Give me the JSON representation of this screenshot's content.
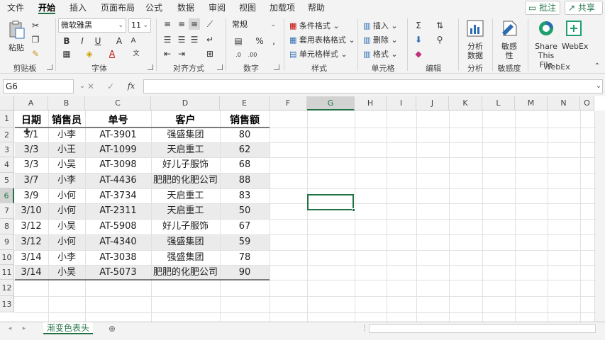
{
  "menu": {
    "tabs": [
      "文件",
      "开始",
      "插入",
      "页面布局",
      "公式",
      "数据",
      "审阅",
      "视图",
      "加载项",
      "帮助"
    ],
    "active_tab": "开始",
    "comment_label": "批注",
    "share_label": "共享"
  },
  "ribbon": {
    "clipboard": {
      "paste_label": "粘贴",
      "group_label": "剪贴板"
    },
    "font": {
      "font_name": "微软雅黑",
      "font_size": "11",
      "group_label": "字体"
    },
    "alignment": {
      "group_label": "对齐方式"
    },
    "number": {
      "format": "常规",
      "group_label": "数字"
    },
    "styles": {
      "conditional_format": "条件格式",
      "table_format": "套用表格格式",
      "cell_styles": "单元格样式",
      "group_label": "样式"
    },
    "cells": {
      "insert": "插入",
      "delete": "删除",
      "format": "格式",
      "group_label": "单元格"
    },
    "editing": {
      "group_label": "编辑"
    },
    "analysis": {
      "button_label_1": "分析",
      "button_label_2": "数据",
      "group_label": "分析"
    },
    "sensitivity": {
      "button_label_1": "敏感",
      "button_label_2": "性",
      "group_label": "敏感度"
    },
    "webex": {
      "share_label_1": "Share",
      "share_label_2": "This File",
      "webex_label": "WebEx",
      "group_label": "WebEx"
    }
  },
  "formula_bar": {
    "name_box": "G6",
    "fx": "fx",
    "value": ""
  },
  "columns": [
    "A",
    "B",
    "C",
    "D",
    "E",
    "F",
    "G",
    "H",
    "I",
    "J",
    "K",
    "L",
    "M",
    "N",
    "O"
  ],
  "selected_column": "G",
  "selected_row": "6",
  "rows": [
    "1",
    "2",
    "3",
    "4",
    "5",
    "6",
    "7",
    "8",
    "9",
    "10",
    "11",
    "12",
    "13"
  ],
  "table": {
    "headers": [
      "日期",
      "销售员",
      "单号",
      "客户",
      "销售额"
    ],
    "records": [
      [
        "3/1",
        "小李",
        "AT-3901",
        "强盛集团",
        "80"
      ],
      [
        "3/3",
        "小王",
        "AT-1099",
        "天启重工",
        "62"
      ],
      [
        "3/3",
        "小吴",
        "AT-3098",
        "好儿子服饰",
        "68"
      ],
      [
        "3/7",
        "小李",
        "AT-4436",
        "肥肥的化肥公司",
        "88"
      ],
      [
        "3/9",
        "小何",
        "AT-3734",
        "天启重工",
        "83"
      ],
      [
        "3/10",
        "小何",
        "AT-2311",
        "天启重工",
        "50"
      ],
      [
        "3/12",
        "小吴",
        "AT-5908",
        "好儿子服饰",
        "67"
      ],
      [
        "3/12",
        "小何",
        "AT-4340",
        "强盛集团",
        "59"
      ],
      [
        "3/14",
        "小李",
        "AT-3038",
        "强盛集团",
        "78"
      ],
      [
        "3/14",
        "小吴",
        "AT-5073",
        "肥肥的化肥公司",
        "90"
      ]
    ]
  },
  "sheet_tab": "渐变色表头",
  "colors": {
    "accent": "#217346",
    "band": "#ebebeb",
    "header_rule": "#7a7a7a"
  }
}
